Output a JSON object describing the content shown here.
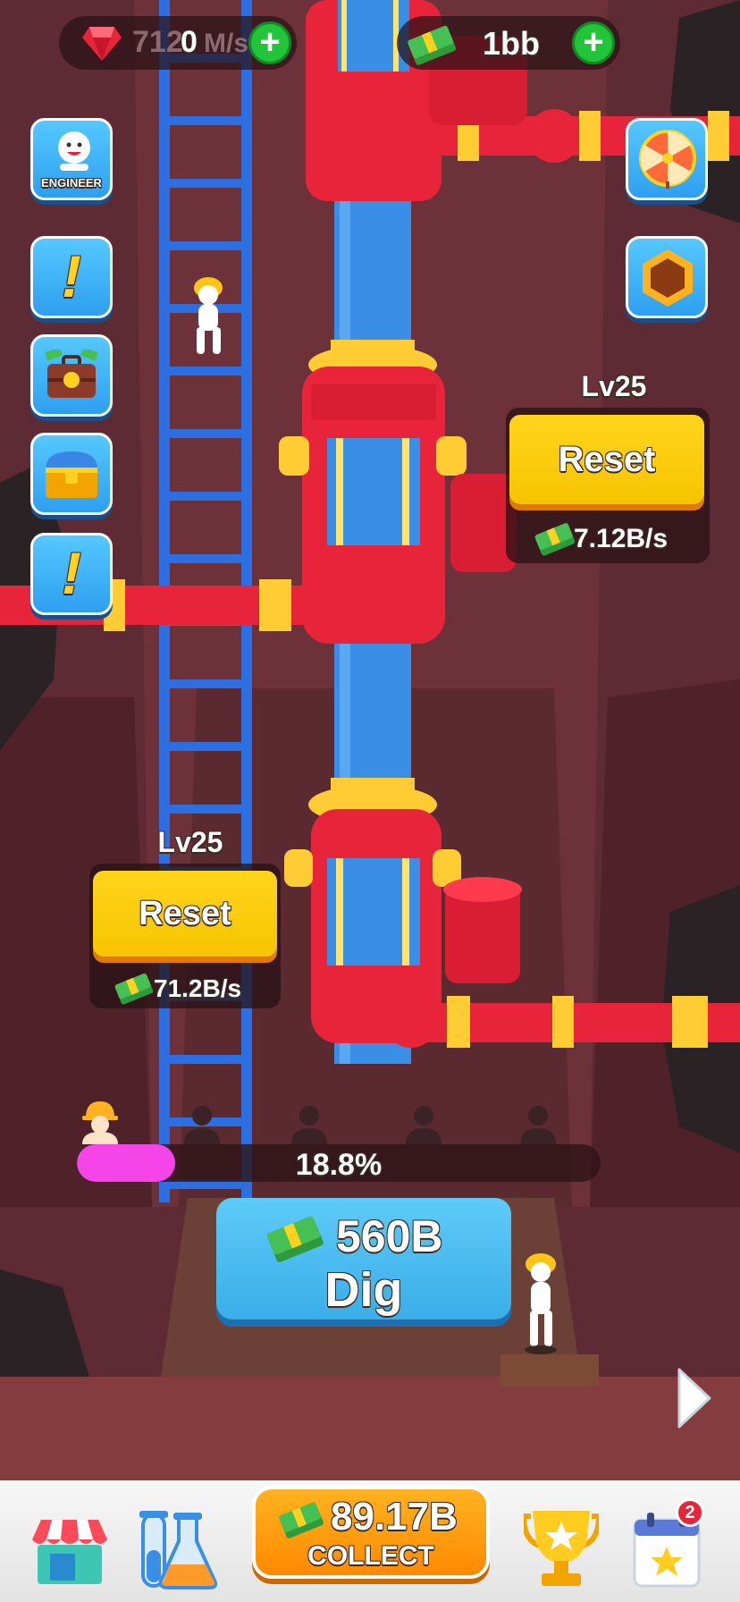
{
  "top_bar": {
    "gems_value": "712",
    "gems_rate": "0",
    "gems_rate_unit": "M/s",
    "cash_value": "1bb",
    "plus_label": "+"
  },
  "side_buttons": {
    "engineer_label": "ENGINEER",
    "alert_glyph": "!"
  },
  "upgrades": [
    {
      "level": "Lv25",
      "button_label": "Reset",
      "rate": "7.12B/s"
    },
    {
      "level": "Lv25",
      "button_label": "Reset",
      "rate": "71.2B/s"
    }
  ],
  "progress": {
    "percent_label": "18.8%",
    "fraction": 0.188
  },
  "dig": {
    "cost": "560B",
    "label": "Dig"
  },
  "collect": {
    "amount": "89.17B",
    "label": "COLLECT"
  },
  "calendar_badge": "2",
  "colors": {
    "pipe_red": "#e8243a",
    "pipe_blue": "#3a8ee6",
    "accent_yellow": "#ffd51c",
    "dig_blue": "#4ec0f5",
    "collect_orange": "#ff9a00",
    "progress_pink": "#f544e8"
  },
  "icons": [
    "ruby-gem-icon",
    "cash-stack-icon",
    "plus-icon",
    "engineer-avatar-icon",
    "exclamation-icon",
    "briefcase-money-icon",
    "treasure-chest-icon",
    "prize-wheel-icon",
    "hexagon-icon",
    "worker-silhouette-icon",
    "next-arrow-icon",
    "shop-icon",
    "lab-flask-icon",
    "trophy-icon",
    "calendar-star-icon"
  ]
}
